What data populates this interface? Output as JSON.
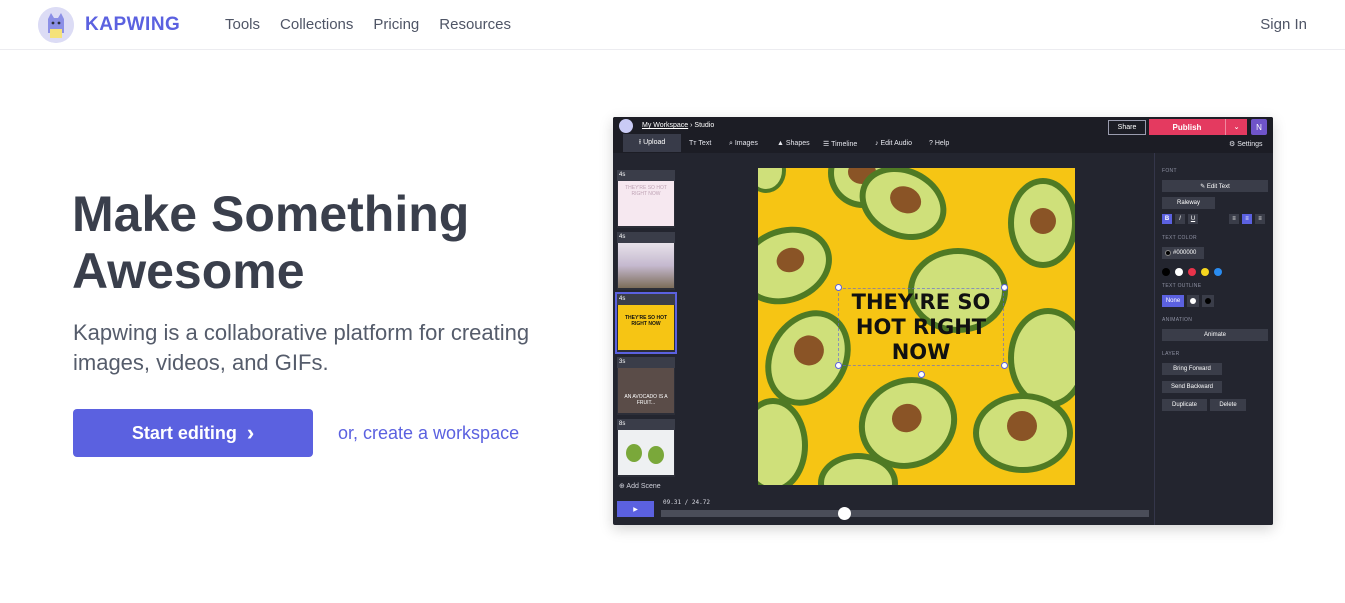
{
  "nav": {
    "brand": "KAPWING",
    "links": [
      "Tools",
      "Collections",
      "Pricing",
      "Resources"
    ],
    "sign_in": "Sign In"
  },
  "hero": {
    "title_line1": "Make Something",
    "title_line2": "Awesome",
    "subtitle": "Kapwing is a collaborative platform for creating images, videos, and GIFs.",
    "cta_label": "Start editing",
    "cta_chevron": "›",
    "alt_link": "or, create a workspace"
  },
  "studio": {
    "breadcrumb_workspace": "My Workspace",
    "breadcrumb_sep": " › ",
    "breadcrumb_page": "Studio",
    "share": "Share",
    "publish": "Publish",
    "publish_caret": "⌄",
    "avatar_initial": "N",
    "toolbar": {
      "upload": "⭱ Upload",
      "text": "Tт Text",
      "images": "⌕ Images",
      "shapes": "▲ Shapes",
      "timeline": "☰ Timeline",
      "edit_audio": "♪ Edit Audio",
      "help": "? Help",
      "settings": "⚙ Settings"
    },
    "scenes": [
      {
        "duration": "4s",
        "thumb_text": "THEY'RE SO HOT RIGHT NOW"
      },
      {
        "duration": "4s",
        "thumb_text": ""
      },
      {
        "duration": "4s",
        "thumb_text": "THEY'RE SO HOT RIGHT NOW"
      },
      {
        "duration": "3s",
        "thumb_text": "AN AVOCADO IS A FRUIT..."
      },
      {
        "duration": "8s",
        "thumb_text": ""
      }
    ],
    "add_scene": "⊕ Add Scene",
    "caption_line1": "THEY'RE SO",
    "caption_line2": "HOT RIGHT",
    "caption_line3": "NOW",
    "timecode_current": "09.31",
    "timecode_sep": " / ",
    "timecode_total": "24.72",
    "play_icon": "▶",
    "playhead_fraction": 0.376,
    "panel": {
      "font_label": "FONT",
      "edit_text": "✎ Edit Text",
      "font_name": "Raleway",
      "bold": "B",
      "italic": "I",
      "underline": "U",
      "text_color_label": "TEXT COLOR",
      "text_color_value": "#000000",
      "text_outline_label": "TEXT OUTLINE",
      "outline_none": "None",
      "animation_label": "ANIMATION",
      "animate": "Animate",
      "layer_label": "LAYER",
      "bring_forward": "Bring Forward",
      "send_backward": "Send Backward",
      "duplicate": "Duplicate",
      "delete": "Delete"
    },
    "swatches": [
      "#000000",
      "#ffffff",
      "#e8334a",
      "#f5d51e",
      "#2a8cf0"
    ]
  },
  "colors": {
    "brand": "#5b61e0",
    "publish": "#e43a60",
    "canvas_bg": "#f6c514",
    "studio_bg": "#23252f"
  }
}
